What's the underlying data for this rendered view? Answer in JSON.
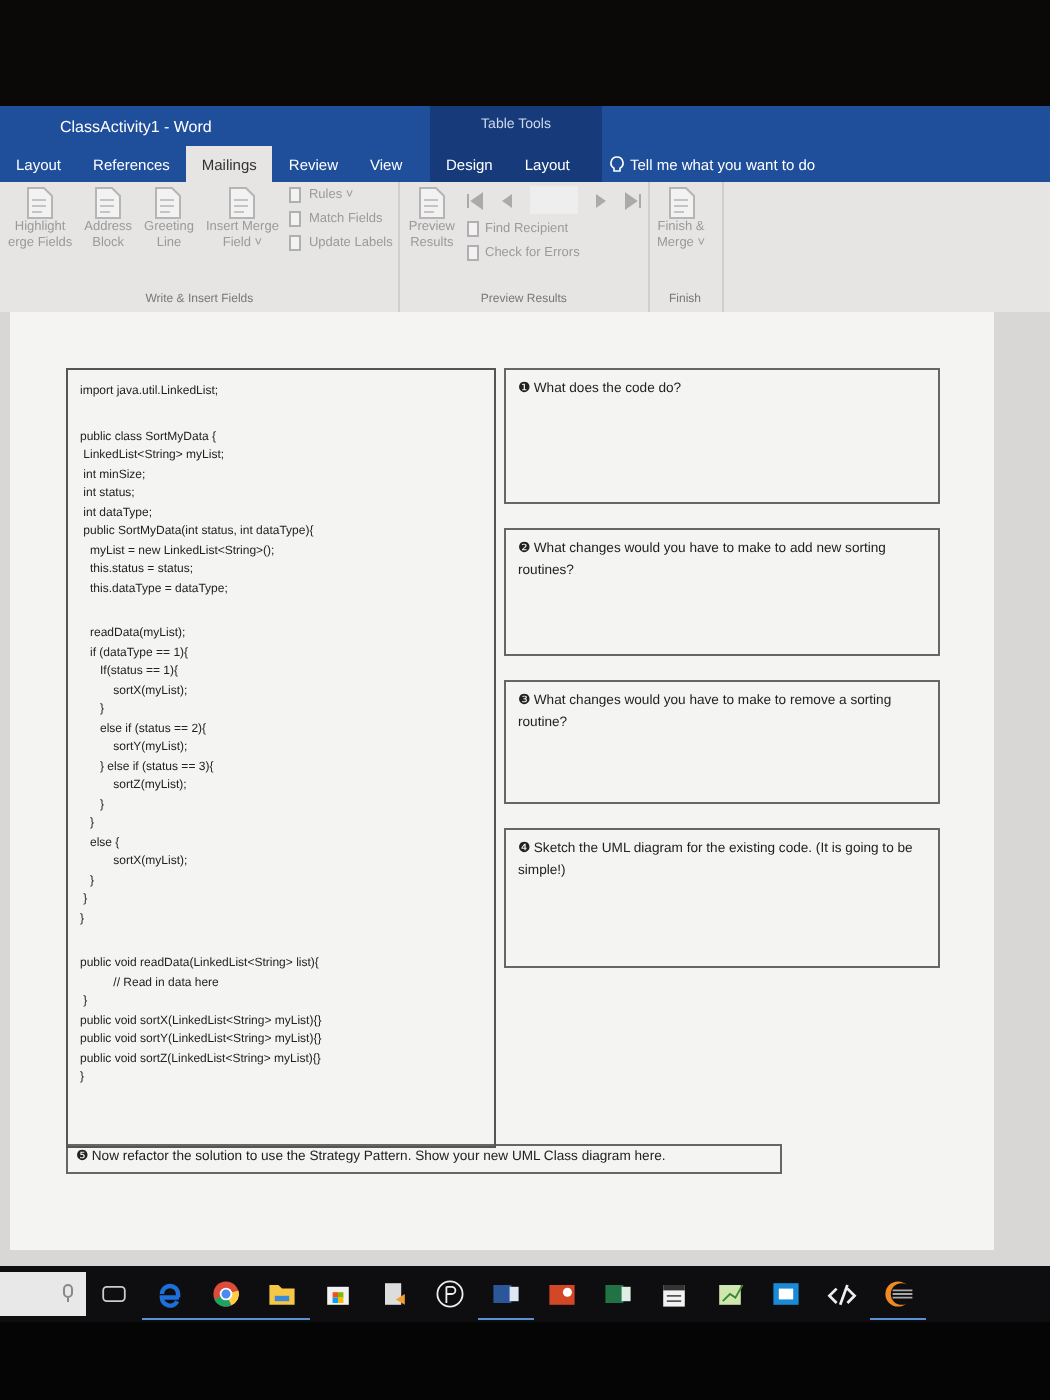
{
  "window": {
    "title": "ClassActivity1  -  Word"
  },
  "tabs": [
    {
      "label": "Layout",
      "selected": false
    },
    {
      "label": "References",
      "selected": false
    },
    {
      "label": "Mailings",
      "selected": true
    },
    {
      "label": "Review",
      "selected": false
    },
    {
      "label": "View",
      "selected": false
    }
  ],
  "context_tabs": {
    "title": "Table Tools",
    "tabs": [
      {
        "label": "Design",
        "selected": false
      },
      {
        "label": "Layout",
        "selected": false
      }
    ]
  },
  "tell_me": "Tell me what you want to do",
  "ribbon": [
    {
      "name": "Write & Insert Fields",
      "large": [
        {
          "lines": [
            "Highlight",
            "erge Fields"
          ]
        },
        {
          "lines": [
            "Address",
            "Block"
          ]
        },
        {
          "lines": [
            "Greeting",
            "Line"
          ]
        },
        {
          "lines": [
            "Insert Merge",
            "Field ˅"
          ]
        }
      ],
      "small": [
        "Rules ˅",
        "Match Fields",
        "Update Labels"
      ]
    },
    {
      "name": "Preview Results",
      "large": [
        {
          "lines": [
            "Preview",
            "Results"
          ]
        }
      ],
      "nav": true,
      "small": [
        "Find Recipient",
        "Check for Errors"
      ]
    },
    {
      "name": "Finish",
      "large": [
        {
          "lines": [
            "Finish &",
            "Merge ˅"
          ]
        }
      ]
    }
  ],
  "code_blocks": [
    [
      "import java.util.LinkedList;"
    ],
    [
      "public class SortMyData {",
      " LinkedList<String> myList;",
      " int minSize;",
      " int status;",
      " int dataType;",
      " public SortMyData(int status, int dataType){",
      "   myList = new LinkedList<String>();",
      "   this.status = status;",
      "   this.dataType = dataType;"
    ],
    [
      "   readData(myList);",
      "   if (dataType == 1){",
      "      If(status == 1){",
      "          sortX(myList);",
      "      }",
      "      else if (status == 2){",
      "          sortY(myList);",
      "      } else if (status == 3){",
      "          sortZ(myList);",
      "      }",
      "   }",
      "   else {",
      "          sortX(myList);",
      "   }",
      " }",
      "}"
    ],
    [
      "public void readData(LinkedList<String> list){",
      "          // Read in data here",
      " }",
      "public void sortX(LinkedList<String> myList){}",
      "public void sortY(LinkedList<String> myList){}",
      "public void sortZ(LinkedList<String> myList){}",
      "}"
    ]
  ],
  "questions": [
    {
      "mark": "❶",
      "text": "What does the code do?"
    },
    {
      "mark": "❷",
      "text": "What changes would you have to make to add new sorting routines?"
    },
    {
      "mark": "❸",
      "text": "What changes would you have to make to remove a sorting routine?"
    },
    {
      "mark": "❹",
      "text": "Sketch the UML diagram for the existing code.  (It is going to be simple!)"
    }
  ],
  "final_question": {
    "mark": "❺",
    "text": "Now refactor the solution to use the Strategy Pattern.  Show your new UML Class diagram here."
  },
  "taskbar": [
    {
      "kind": "taskview",
      "running": false
    },
    {
      "kind": "edge",
      "running": true
    },
    {
      "kind": "chrome",
      "running": true
    },
    {
      "kind": "folder",
      "running": true
    },
    {
      "kind": "store",
      "running": false
    },
    {
      "kind": "doc",
      "running": false
    },
    {
      "kind": "p3",
      "running": false
    },
    {
      "kind": "word",
      "running": true
    },
    {
      "kind": "ppt",
      "running": false
    },
    {
      "kind": "excel",
      "running": false
    },
    {
      "kind": "calendar",
      "running": false
    },
    {
      "kind": "sheet",
      "running": false
    },
    {
      "kind": "frame",
      "running": false
    },
    {
      "kind": "code",
      "running": false
    },
    {
      "kind": "eclipse",
      "running": true
    }
  ]
}
